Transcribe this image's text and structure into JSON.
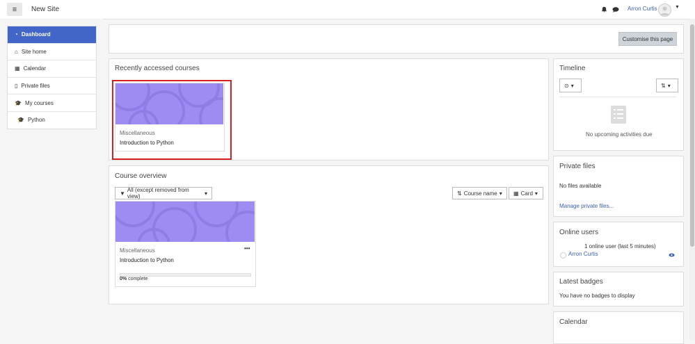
{
  "header": {
    "site_name": "New Site",
    "user_name": "Arron Curtis",
    "menu_icon": "hamburger-icon",
    "notifications_icon": "bell-icon",
    "messages_icon": "chat-icon"
  },
  "nav": {
    "items": [
      {
        "label": "Dashboard",
        "icon": "dashboard-icon"
      },
      {
        "label": "Site home",
        "icon": "home-icon"
      },
      {
        "label": "Calendar",
        "icon": "calendar-icon"
      },
      {
        "label": "Private files",
        "icon": "file-icon"
      },
      {
        "label": "My courses",
        "icon": "graduation-cap-icon"
      },
      {
        "label": "Python",
        "icon": "graduation-cap-icon"
      }
    ]
  },
  "page": {
    "customise_label": "Customise this page"
  },
  "recent": {
    "title": "Recently accessed courses",
    "category": "Miscellaneous",
    "course": "Introduction to Python"
  },
  "overview": {
    "title": "Course overview",
    "filter_label": "All (except removed from view)",
    "sort_label": "Course name",
    "view_label": "Card",
    "category": "Miscellaneous",
    "course": "Introduction to Python",
    "menu": "•••",
    "progress_pct": "0%",
    "progress_suffix": " complete",
    "progress_value": 0
  },
  "timeline": {
    "title": "Timeline",
    "empty": "No upcoming activities due"
  },
  "private_files": {
    "title": "Private files",
    "empty": "No files available",
    "manage_link": "Manage private files..."
  },
  "online_users": {
    "title": "Online users",
    "summary": "1 online user (last 5 minutes)",
    "user": "Arron Curtis"
  },
  "badges": {
    "title": "Latest badges",
    "empty": "You have no badges to display"
  },
  "calendar": {
    "title": "Calendar"
  },
  "colors": {
    "accent": "#4266c7",
    "course_image": "#9e8cf2",
    "highlight": "#d81e1e"
  }
}
